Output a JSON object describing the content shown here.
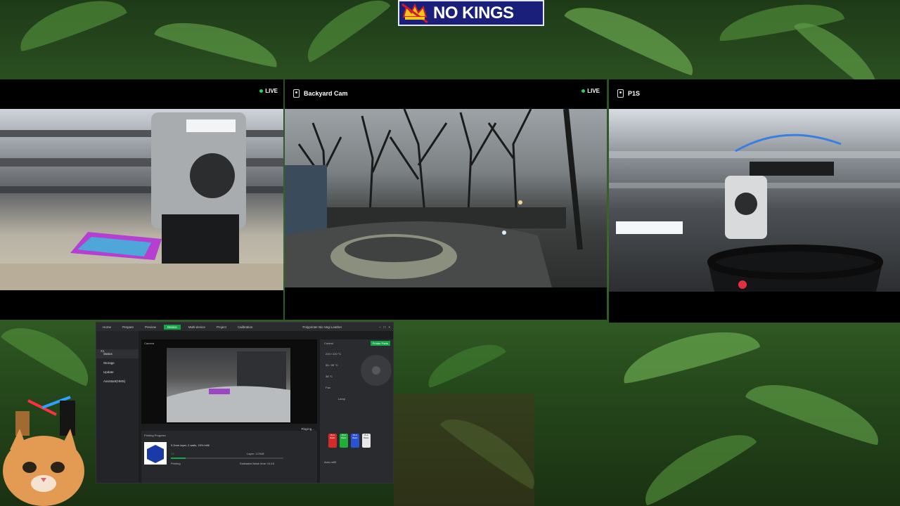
{
  "banner": {
    "text": "NO KINGS"
  },
  "cameras": [
    {
      "title": "",
      "live": "LIVE"
    },
    {
      "title": "Backyard Cam",
      "live": "LIVE"
    },
    {
      "title": "P1S",
      "live": ""
    }
  ],
  "software": {
    "tabs": [
      "Home",
      "Prepare",
      "Preview",
      "Device",
      "Multi-device",
      "Project",
      "Calibration"
    ],
    "window_title": "Polyprinter Bio Vegi Leather",
    "sidebar": [
      "Status",
      "Storage",
      "Update",
      "Assistant(HMS)"
    ],
    "printer": "X1",
    "camera_label": "Camera",
    "playing": "Playing...",
    "control_label": "Control",
    "printer_parts": "Printer Parts",
    "temps": [
      "220 / 220 °C",
      "55 / 55 °C",
      "38 °C"
    ],
    "fan_label": "Fan",
    "lamp_label": "Lamp",
    "progress_title": "Printing Progress",
    "job": "0.2mm layer, 2 walls, 15% infill",
    "layer": "Layer: 17/048",
    "percent": "13",
    "status": "Printing",
    "estimate": "Estimated finish time: 04:15",
    "auto_refill": "Auto-refill",
    "spools": [
      "PLA Basic",
      "PLA Basic",
      "PLA Basic",
      "PLA Basic"
    ]
  },
  "colors": {
    "accent": "#17a34a",
    "banner_bg": "#1a1f7a",
    "live_dot": "#27d35a"
  }
}
